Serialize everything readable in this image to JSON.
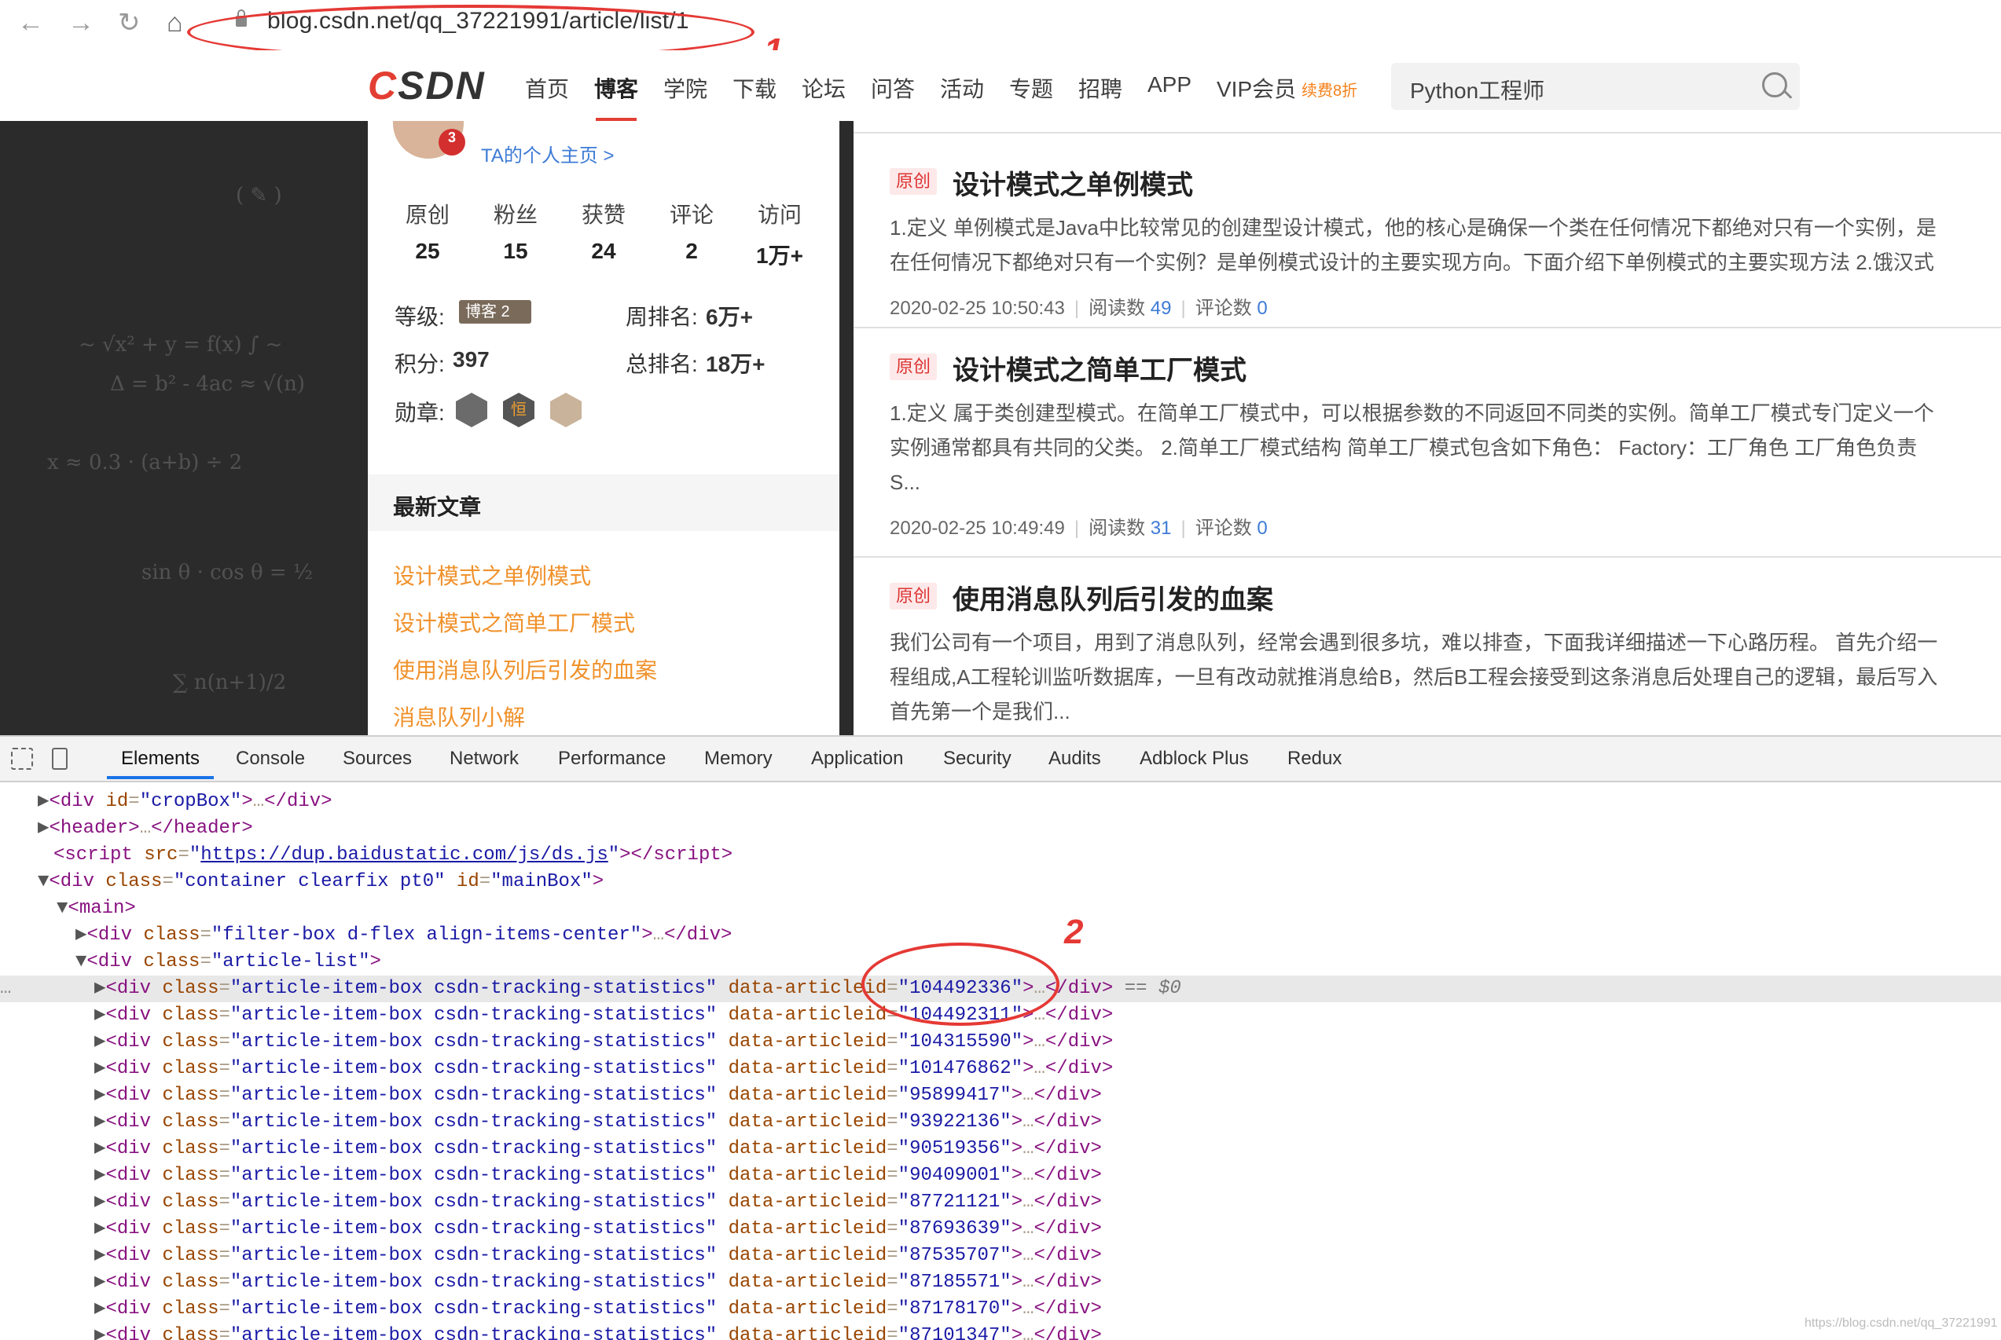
{
  "browser": {
    "url": "blog.csdn.net/qq_37221991/article/list/1",
    "icons": [
      "back-icon",
      "forward-icon",
      "reload-icon",
      "home-icon",
      "lock-icon"
    ]
  },
  "annotations": {
    "one": "1",
    "two": "2"
  },
  "csdn": {
    "logo": "CSDN",
    "nav": [
      "首页",
      "博客",
      "学院",
      "下载",
      "论坛",
      "问答",
      "活动",
      "专题",
      "招聘",
      "APP",
      "VIP会员"
    ],
    "vip_extra": "续费8折",
    "search_text": "Python工程师"
  },
  "profile": {
    "years": "3",
    "home_link": "TA的个人主页 >",
    "stats": [
      {
        "label": "原创",
        "value": "25"
      },
      {
        "label": "粉丝",
        "value": "15"
      },
      {
        "label": "获赞",
        "value": "24"
      },
      {
        "label": "评论",
        "value": "2"
      },
      {
        "label": "访问",
        "value": "1万+"
      }
    ],
    "level_label": "等级:",
    "level_badge": "博客 2",
    "week_rank_label": "周排名:",
    "week_rank": "6万+",
    "points_label": "积分:",
    "points": "397",
    "total_rank_label": "总排名:",
    "total_rank": "18万+",
    "medals_label": "勋章:",
    "medal2_char": "恒"
  },
  "recent": {
    "title": "最新文章",
    "items": [
      "设计模式之单例模式",
      "设计模式之简单工厂模式",
      "使用消息队列后引发的血案",
      "消息队列小解"
    ]
  },
  "articles": [
    {
      "badge": "原创",
      "title": "设计模式之单例模式",
      "desc1": "1.定义 单例模式是Java中比较常见的创建型设计模式，他的核心是确保一个类在任何情况下都绝对只有一个实例，是",
      "desc2": "在任何情况下都绝对只有一个实例？是单例模式设计的主要实现方向。下面介绍下单例模式的主要实现方法 2.饿汉式",
      "desc3": "",
      "date": "2020-02-25 10:50:43",
      "read_label": "阅读数",
      "reads": "49",
      "comment_label": "评论数",
      "comments": "0"
    },
    {
      "badge": "原创",
      "title": "设计模式之简单工厂模式",
      "desc1": "1.定义 属于类创建型模式。在简单工厂模式中，可以根据参数的不同返回不同类的实例。简单工厂模式专门定义一个",
      "desc2": "实例通常都具有共同的父类。 2.简单工厂模式结构 简单工厂模式包含如下角色： Factory：工厂角色 工厂角色负责",
      "desc3": "S...",
      "date": "2020-02-25 10:49:49",
      "read_label": "阅读数",
      "reads": "31",
      "comment_label": "评论数",
      "comments": "0"
    },
    {
      "badge": "原创",
      "title": "使用消息队列后引发的血案",
      "desc1": "我们公司有一个项目，用到了消息队列，经常会遇到很多坑，难以排查，下面我详细描述一下心路历程。 首先介绍一",
      "desc2": "程组成,A工程轮训监听数据库，一旦有改动就推消息给B，然后B工程会接受到这条消息后处理自己的逻辑，最后写入",
      "desc3": "首先第一个是我们..."
    }
  ],
  "devtools": {
    "tabs": [
      "Elements",
      "Console",
      "Sources",
      "Network",
      "Performance",
      "Memory",
      "Application",
      "Security",
      "Audits",
      "Adblock Plus",
      "Redux"
    ],
    "dom": {
      "l1_id": "cropBox",
      "l2_tag": "header",
      "l3_src": "https://dup.baidustatic.com/js/ds.js",
      "l4_class": "container clearfix pt0",
      "l4_id": "mainBox",
      "l5_tag": "main",
      "l6_class": "filter-box d-flex align-items-center",
      "l7_class": "article-list",
      "item_class": "article-item-box csdn-tracking-statistics",
      "item_attr": "data-articleid",
      "selected_marker": "== $0",
      "article_ids": [
        "104492336",
        "104492311",
        "104315590",
        "101476862",
        "95899417",
        "93922136",
        "90519356",
        "90409001",
        "87721121",
        "87693639",
        "87535707",
        "87185571",
        "87178170",
        "87101347"
      ]
    }
  },
  "watermark": "https://blog.csdn.net/qq_37221991"
}
